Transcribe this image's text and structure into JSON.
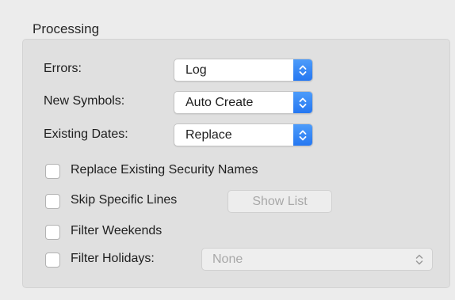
{
  "group": {
    "title": "Processing"
  },
  "errors": {
    "label": "Errors:",
    "value": "Log"
  },
  "new_symbols": {
    "label": "New Symbols:",
    "value": "Auto Create"
  },
  "existing_dates": {
    "label": "Existing Dates:",
    "value": "Replace"
  },
  "checkboxes": {
    "replace_names": {
      "label": "Replace Existing Security Names",
      "checked": false
    },
    "skip_lines": {
      "label": "Skip Specific Lines",
      "checked": false
    },
    "filter_weekends": {
      "label": "Filter Weekends",
      "checked": false
    },
    "filter_holidays": {
      "label": "Filter Holidays:",
      "checked": false
    }
  },
  "show_list_button": {
    "label": "Show List",
    "enabled": false
  },
  "holidays_popup": {
    "value": "None",
    "enabled": false
  },
  "colors": {
    "accent": "#2f82f6",
    "panel": "#e0e0e0",
    "window": "#ececec",
    "disabled_text": "#a8a8a8"
  },
  "icons": {
    "popup": "updown-chevron-icon"
  }
}
